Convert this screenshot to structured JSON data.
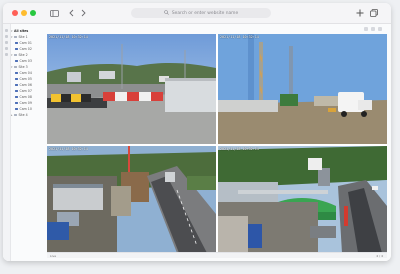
{
  "browser": {
    "address_placeholder": "Search or enter website name",
    "icons": [
      "sidebar-icon",
      "back-icon",
      "forward-icon",
      "search-icon",
      "plus-icon",
      "tabs-icon"
    ]
  },
  "sidebar": {
    "root_label": "All sites",
    "items": [
      {
        "label": "Site 1"
      },
      {
        "label": "Cam 01"
      },
      {
        "label": "Cam 02"
      },
      {
        "label": "Site 2"
      },
      {
        "label": "Cam 03"
      },
      {
        "label": "Site 3"
      },
      {
        "label": "Cam 04"
      },
      {
        "label": "Cam 05"
      },
      {
        "label": "Cam 06"
      },
      {
        "label": "Cam 07"
      },
      {
        "label": "Cam 08"
      },
      {
        "label": "Cam 09"
      },
      {
        "label": "Cam 10"
      },
      {
        "label": "Site 4"
      }
    ]
  },
  "cameras": [
    {
      "timestamp": "2021/11/18 10:32:14"
    },
    {
      "timestamp": "2021/11/18 10:32:14"
    },
    {
      "timestamp": "2021/11/18 10:32:14"
    },
    {
      "timestamp": "2021/11/18 10:32:14"
    }
  ],
  "footer": {
    "left": "Live",
    "right": "4 / 4"
  },
  "colors": {
    "titlebar": "#f5f5f7",
    "accent": "#4d6fb8"
  }
}
